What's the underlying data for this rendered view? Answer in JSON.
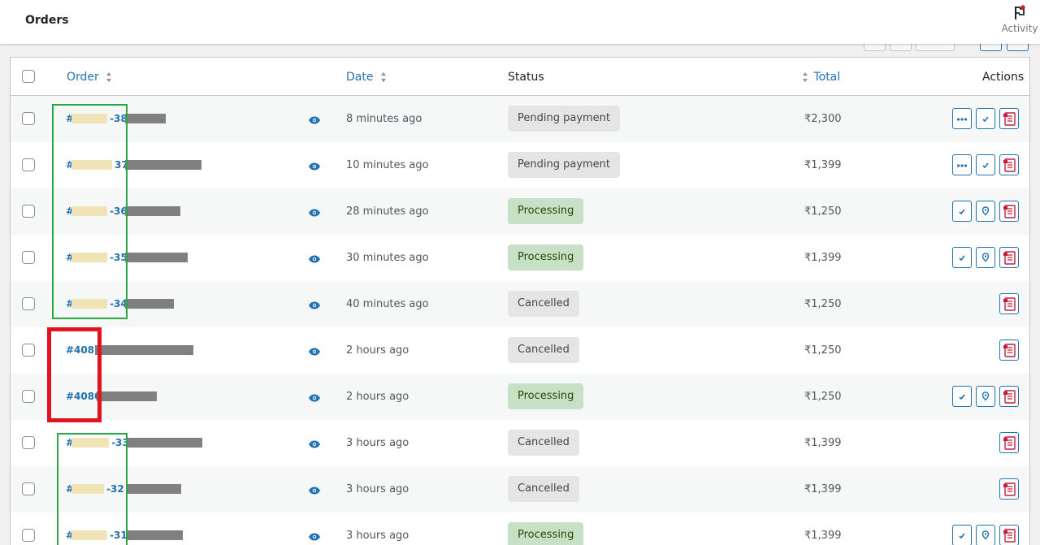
{
  "header": {
    "title": "Orders",
    "activity_label": "Activity"
  },
  "table": {
    "columns": {
      "order": "Order",
      "date": "Date",
      "status": "Status",
      "total": "Total",
      "actions": "Actions"
    },
    "rows": [
      {
        "order_prefix": "#",
        "order_suffix": "-38",
        "date": "8 minutes ago",
        "status": "Pending payment",
        "status_kind": "pending",
        "total": "₹2,300",
        "actions": [
          "more",
          "complete",
          "invoice"
        ]
      },
      {
        "order_prefix": "#",
        "order_suffix": "37",
        "date": "10 minutes ago",
        "status": "Pending payment",
        "status_kind": "pending",
        "total": "₹1,399",
        "actions": [
          "more",
          "complete",
          "invoice"
        ]
      },
      {
        "order_prefix": "#",
        "order_suffix": "-36",
        "date": "28 minutes ago",
        "status": "Processing",
        "status_kind": "processing",
        "total": "₹1,250",
        "actions": [
          "complete",
          "track",
          "invoice"
        ]
      },
      {
        "order_prefix": "#",
        "order_suffix": "-35",
        "date": "30 minutes ago",
        "status": "Processing",
        "status_kind": "processing",
        "total": "₹1,399",
        "actions": [
          "complete",
          "track",
          "invoice"
        ]
      },
      {
        "order_prefix": "#",
        "order_suffix": "-34",
        "date": "40 minutes ago",
        "status": "Cancelled",
        "status_kind": "cancelled",
        "total": "₹1,250",
        "actions": [
          "invoice"
        ]
      },
      {
        "order_prefix": "#4081",
        "order_suffix": "",
        "date": "2 hours ago",
        "status": "Cancelled",
        "status_kind": "cancelled",
        "total": "₹1,250",
        "actions": [
          "invoice"
        ]
      },
      {
        "order_prefix": "#4080",
        "order_suffix": "",
        "date": "2 hours ago",
        "status": "Processing",
        "status_kind": "processing",
        "total": "₹1,250",
        "actions": [
          "complete",
          "track",
          "invoice"
        ]
      },
      {
        "order_prefix": "#",
        "order_suffix": "-33",
        "date": "3 hours ago",
        "status": "Cancelled",
        "status_kind": "cancelled",
        "total": "₹1,399",
        "actions": [
          "invoice"
        ]
      },
      {
        "order_prefix": "#",
        "order_suffix": "-32",
        "date": "3 hours ago",
        "status": "Cancelled",
        "status_kind": "cancelled",
        "total": "₹1,399",
        "actions": [
          "invoice"
        ]
      },
      {
        "order_prefix": "#",
        "order_suffix": "-31",
        "date": "3 hours ago",
        "status": "Processing",
        "status_kind": "processing",
        "total": "₹1,399",
        "actions": [
          "complete",
          "track",
          "invoice"
        ]
      }
    ]
  },
  "colors": {
    "link": "#2271b1",
    "processing_bg": "#c6e1c6",
    "pending_bg": "#e5e5e5",
    "highlight_green": "#28a745",
    "highlight_red": "#e0141e"
  }
}
